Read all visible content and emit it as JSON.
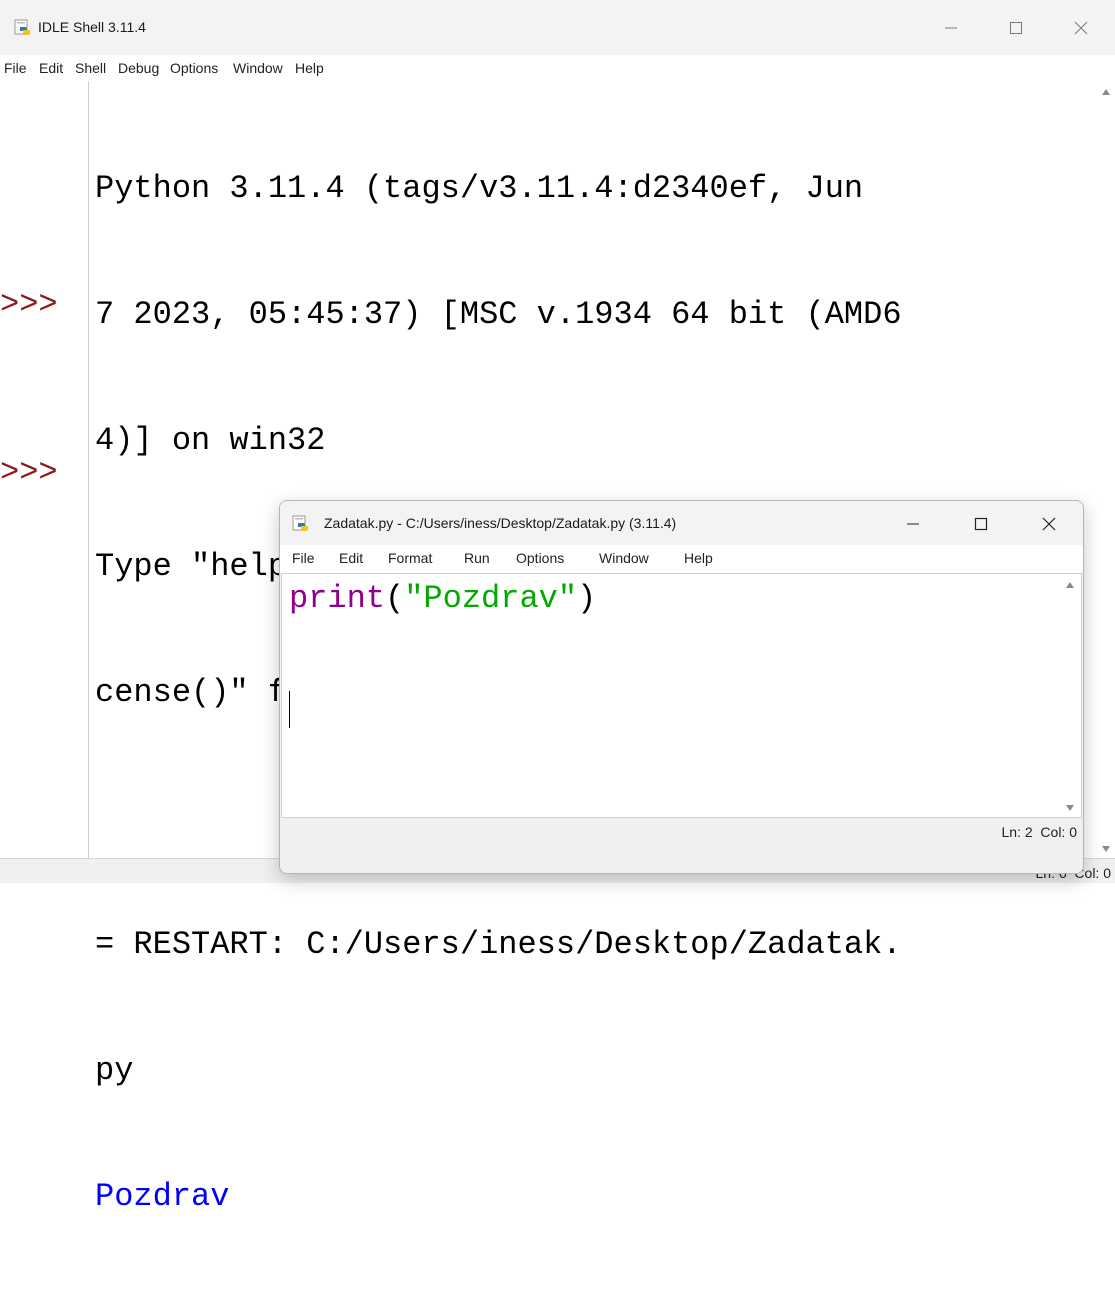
{
  "shell": {
    "title": "IDLE Shell 3.11.4",
    "menu": [
      "File",
      "Edit",
      "Shell",
      "Debug",
      "Options",
      "Window",
      "Help"
    ],
    "prompt": ">>>",
    "lines": [
      "Python 3.11.4 (tags/v3.11.4:d2340ef, Jun",
      "7 2023, 05:45:37) [MSC v.1934 64 bit (AMD6",
      "4)] on win32",
      "Type \"help\", \"copyright\", \"credits\" or \"li",
      "cense()\" for more information."
    ],
    "restart_lines": [
      "= RESTART: C:/Users/iness/Desktop/Zadatak.",
      "py"
    ],
    "output": "Pozdrav",
    "status": "Ln: 6  Col: 0",
    "colors": {
      "prompt": "#8b1a1a",
      "output": "#0000ff"
    }
  },
  "editor": {
    "title": "Zadatak.py - C:/Users/iness/Desktop/Zadatak.py (3.11.4)",
    "menu": [
      "File",
      "Edit",
      "Format",
      "Run",
      "Options",
      "Window",
      "Help"
    ],
    "code": {
      "keyword": "print",
      "open": "(",
      "string": "\"Pozdrav\"",
      "close": ")"
    },
    "status": "Ln: 2  Col: 0",
    "colors": {
      "keyword": "#900090",
      "string": "#00aa00"
    }
  },
  "icons": [
    "python-idle-icon",
    "minimize-icon",
    "maximize-icon",
    "close-icon",
    "scroll-up-arrow-icon",
    "scroll-down-arrow-icon"
  ]
}
